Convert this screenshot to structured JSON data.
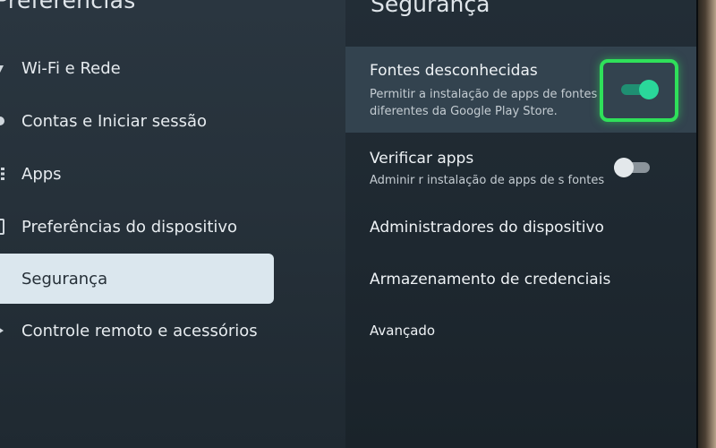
{
  "left_panel": {
    "title": "Preferências",
    "items": [
      {
        "label": "Wi-Fi e Rede",
        "icon": "wifi-icon",
        "selected": false
      },
      {
        "label": "Contas e Iniciar sessão",
        "icon": "account-icon",
        "selected": false
      },
      {
        "label": "Apps",
        "icon": "apps-icon",
        "selected": false
      },
      {
        "label": "Preferências do dispositivo",
        "icon": "device-icon",
        "selected": false
      },
      {
        "label": "Segurança",
        "icon": "lock-icon",
        "selected": true
      },
      {
        "label": "Controle remoto e acessórios",
        "icon": "remote-icon",
        "selected": false
      }
    ]
  },
  "right_panel": {
    "title": "Segurança",
    "unknown_sources": {
      "title": "Fontes desconhecidas",
      "subtitle_line1": "Permitir a instalação de apps de fontes",
      "subtitle_line2": "diferentes da Google Play Store.",
      "enabled": true
    },
    "verify_apps": {
      "title": "Verificar apps",
      "subtitle": "Adminir r instalação de apps de s fontes",
      "enabled": false
    },
    "device_admins": {
      "title": "Administradores do dispositivo"
    },
    "credential_storage": {
      "title": "Armazenamento de credenciais"
    },
    "advanced": {
      "title": "Avançado"
    }
  },
  "colors": {
    "toggle_on": "#2ad79a",
    "focus_ring": "#2fe05a",
    "selected_item_bg": "#dbe7ee"
  }
}
